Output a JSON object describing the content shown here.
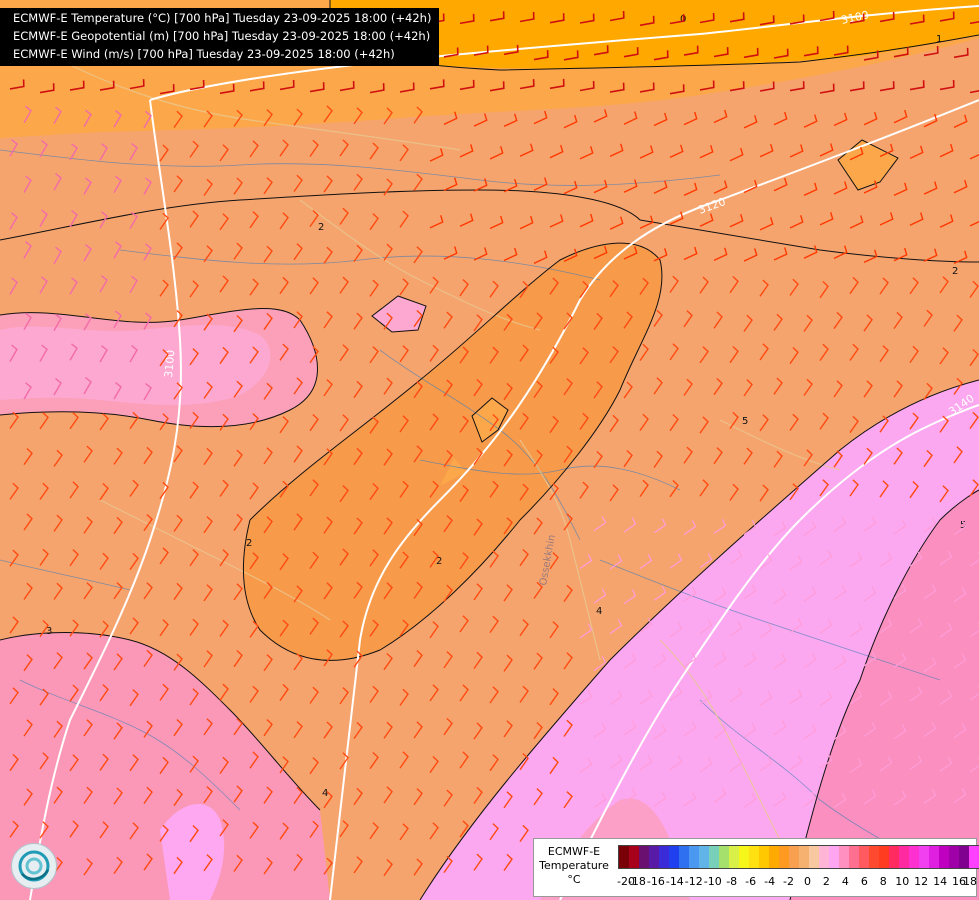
{
  "titles": [
    "ECMWF-E Temperature (°C) [700 hPa] Tuesday 23-09-2025 18:00 (+42h)",
    "ECMWF-E Geopotential (m) [700 hPa] Tuesday 23-09-2025 18:00 (+42h)",
    "ECMWF-E Wind (m/s) [700 hPa] Tuesday 23-09-2025 18:00 (+42h)"
  ],
  "legend": {
    "label_lines": [
      "ECMWF-E",
      "Temperature",
      "°C"
    ],
    "colors": [
      "#7a0008",
      "#a8001a",
      "#6a1070",
      "#5a1aa8",
      "#3a2ad8",
      "#2040f0",
      "#2f70f0",
      "#4a98f0",
      "#60b4e8",
      "#78d0b8",
      "#a6e06c",
      "#d8f048",
      "#f6f61a",
      "#ffe010",
      "#ffc800",
      "#ffaa00",
      "#ff9a20",
      "#f8a050",
      "#f6b070",
      "#f8c8a0",
      "#ffb6d6",
      "#ffa6f2",
      "#ff90c0",
      "#ff7090",
      "#ff5a60",
      "#ff4a30",
      "#ff3c20",
      "#ff2a60",
      "#ff2aa0",
      "#ff30d0",
      "#f040f0",
      "#e020e0",
      "#c000c0",
      "#a000a8",
      "#800090",
      "#ff40ff"
    ],
    "tick_labels": [
      "-20",
      "-18",
      "-16",
      "-14",
      "-12",
      "-10",
      "-8",
      "-6",
      "-4",
      "-2",
      "0",
      "2",
      "4",
      "6",
      "8",
      "10",
      "12",
      "14",
      "16",
      "18"
    ]
  },
  "contour_labels": {
    "temperature": [
      "0",
      "1",
      "2",
      "2",
      "2",
      "2",
      "3",
      "4",
      "4",
      "5",
      "5"
    ],
    "geopotential": [
      "3100",
      "3120",
      "3100",
      "3140"
    ]
  },
  "overlay_labels": [
    "Ossekkhin"
  ]
}
